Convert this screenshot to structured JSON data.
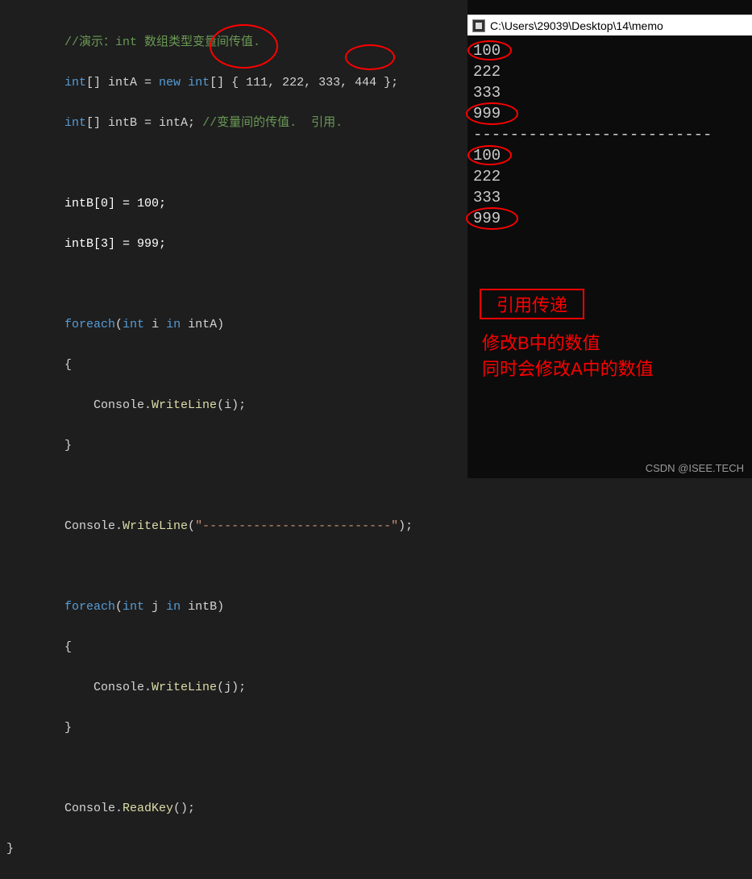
{
  "code": {
    "comment1": "//演示：int 数组类型变量间传值.",
    "l2_p1": "int",
    "l2_p2": "[] intA = ",
    "l2_p3": "new",
    "l2_p4": " int",
    "l2_p5": "[] { 111, 222, 333, 444 };",
    "l3_p1": "int",
    "l3_p2": "[] intB = intA; ",
    "l3_comment": "//变量间的传值.  引用.",
    "l5": "intB[0] = 100;",
    "l6": "intB[3] = 999;",
    "l8_p1": "foreach",
    "l8_p2": "(",
    "l8_p3": "int",
    "l8_p4": " i ",
    "l8_p5": "in",
    "l8_p6": " intA)",
    "l9": "{",
    "l10_p1": "    Console.",
    "l10_m": "WriteLine",
    "l10_p2": "(i);",
    "l11": "}",
    "l13_p1": "Console.",
    "l13_m": "WriteLine",
    "l13_p2": "(",
    "l13_s": "\"--------------------------\"",
    "l13_p3": ");",
    "l15_p1": "foreach",
    "l15_p2": "(",
    "l15_p3": "int",
    "l15_p4": " j ",
    "l15_p5": "in",
    "l15_p6": " intB)",
    "l16": "{",
    "l17_p1": "    Console.",
    "l17_m": "WriteLine",
    "l17_p2": "(j);",
    "l18": "}",
    "l20_p1": "Console.",
    "l20_m": "ReadKey",
    "l20_p2": "();",
    "close_brace": "}"
  },
  "console": {
    "title": "C:\\Users\\29039\\Desktop\\14\\memo",
    "lines": [
      "100",
      "222",
      "333",
      "999",
      "--------------------------",
      "100",
      "222",
      "333",
      "999"
    ]
  },
  "annotations": {
    "box_label": "引用传递",
    "line2": "修改B中的数值",
    "line3": "同时会修改A中的数值"
  },
  "watermark": "CSDN @ISEE.TECH"
}
